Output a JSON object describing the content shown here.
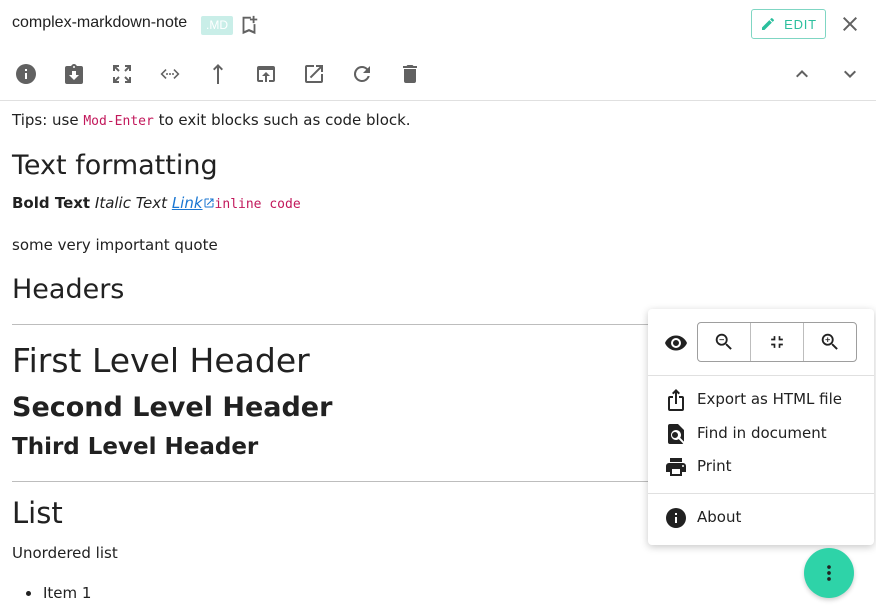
{
  "header": {
    "title": "complex-markdown-note",
    "badge": ".MD",
    "edit_label": "EDIT"
  },
  "toolbar": {
    "icons": [
      "info-icon",
      "download-icon",
      "fullscreen-icon",
      "code-icon",
      "share-up-icon",
      "open-in-icon",
      "external-link-icon",
      "refresh-icon",
      "delete-icon",
      "chevron-up-icon",
      "chevron-down-icon"
    ]
  },
  "content": {
    "tips_prefix": "Tips: use ",
    "tips_code": "Mod-Enter",
    "tips_suffix": " to exit blocks such as code block.",
    "h_text_formatting": "Text formatting",
    "bold_text": "Bold Text",
    "italic_text": "Italic Text",
    "link_text": "Link",
    "inline_code": "inline code",
    "quote": "some very important quote",
    "h_headers": "Headers",
    "h1": "First Level Header",
    "h2": "Second Level Header",
    "h3": "Third Level Header",
    "h_list": "List",
    "unordered_label": "Unordered list",
    "item1": "Item 1"
  },
  "menu": {
    "export_label": "Export as HTML file",
    "find_label": "Find in document",
    "print_label": "Print",
    "about_label": "About"
  },
  "colors": {
    "accent": "#2ed3a8",
    "edit_text": "#2bbf9d",
    "code": "#c2185b",
    "link": "#1976d2",
    "icon": "#616161"
  }
}
